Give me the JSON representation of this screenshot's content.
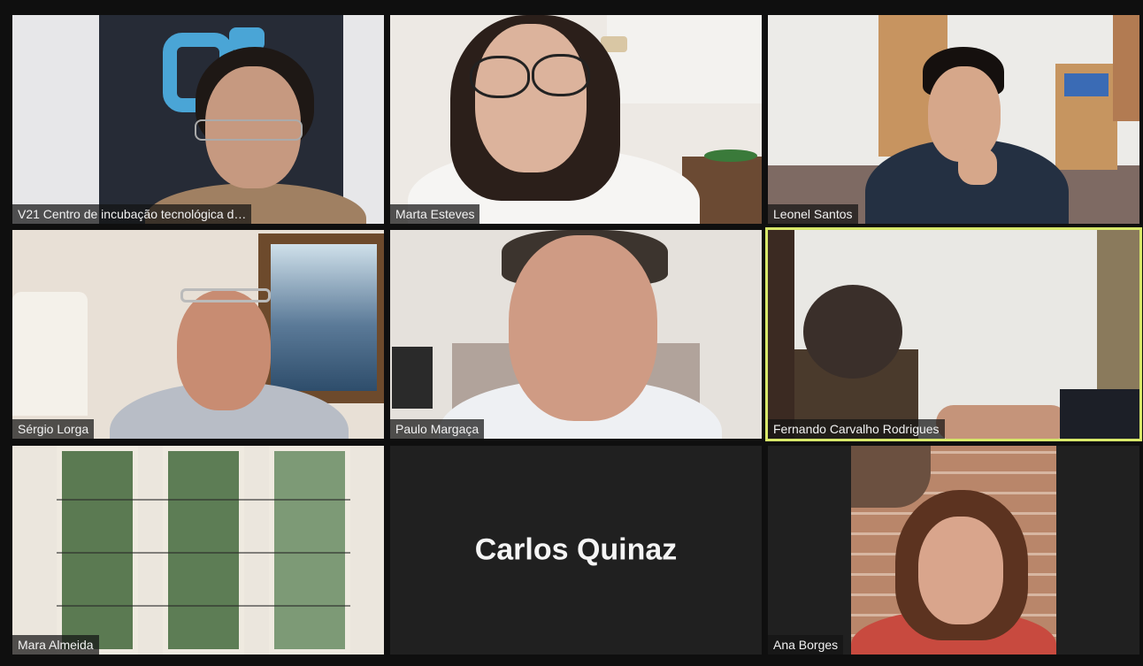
{
  "participants": [
    {
      "name": "V21 Centro de incubação tecnológica d…",
      "video": true
    },
    {
      "name": "Marta Esteves",
      "video": true
    },
    {
      "name": "Leonel Santos",
      "video": true
    },
    {
      "name": "Sérgio Lorga",
      "video": true
    },
    {
      "name": "Paulo Margaça",
      "video": true
    },
    {
      "name": "Fernando Carvalho Rodrigues",
      "video": true,
      "active_speaker": true
    },
    {
      "name": "Mara Almeida",
      "video": true
    },
    {
      "name": "Carlos Quinaz",
      "video": false
    },
    {
      "name": "Ana Borges",
      "video": true
    }
  ],
  "colors": {
    "active_speaker_border": "#d8e86a",
    "tile_background": "#1f1f1f",
    "page_background": "#0f0f0f"
  }
}
